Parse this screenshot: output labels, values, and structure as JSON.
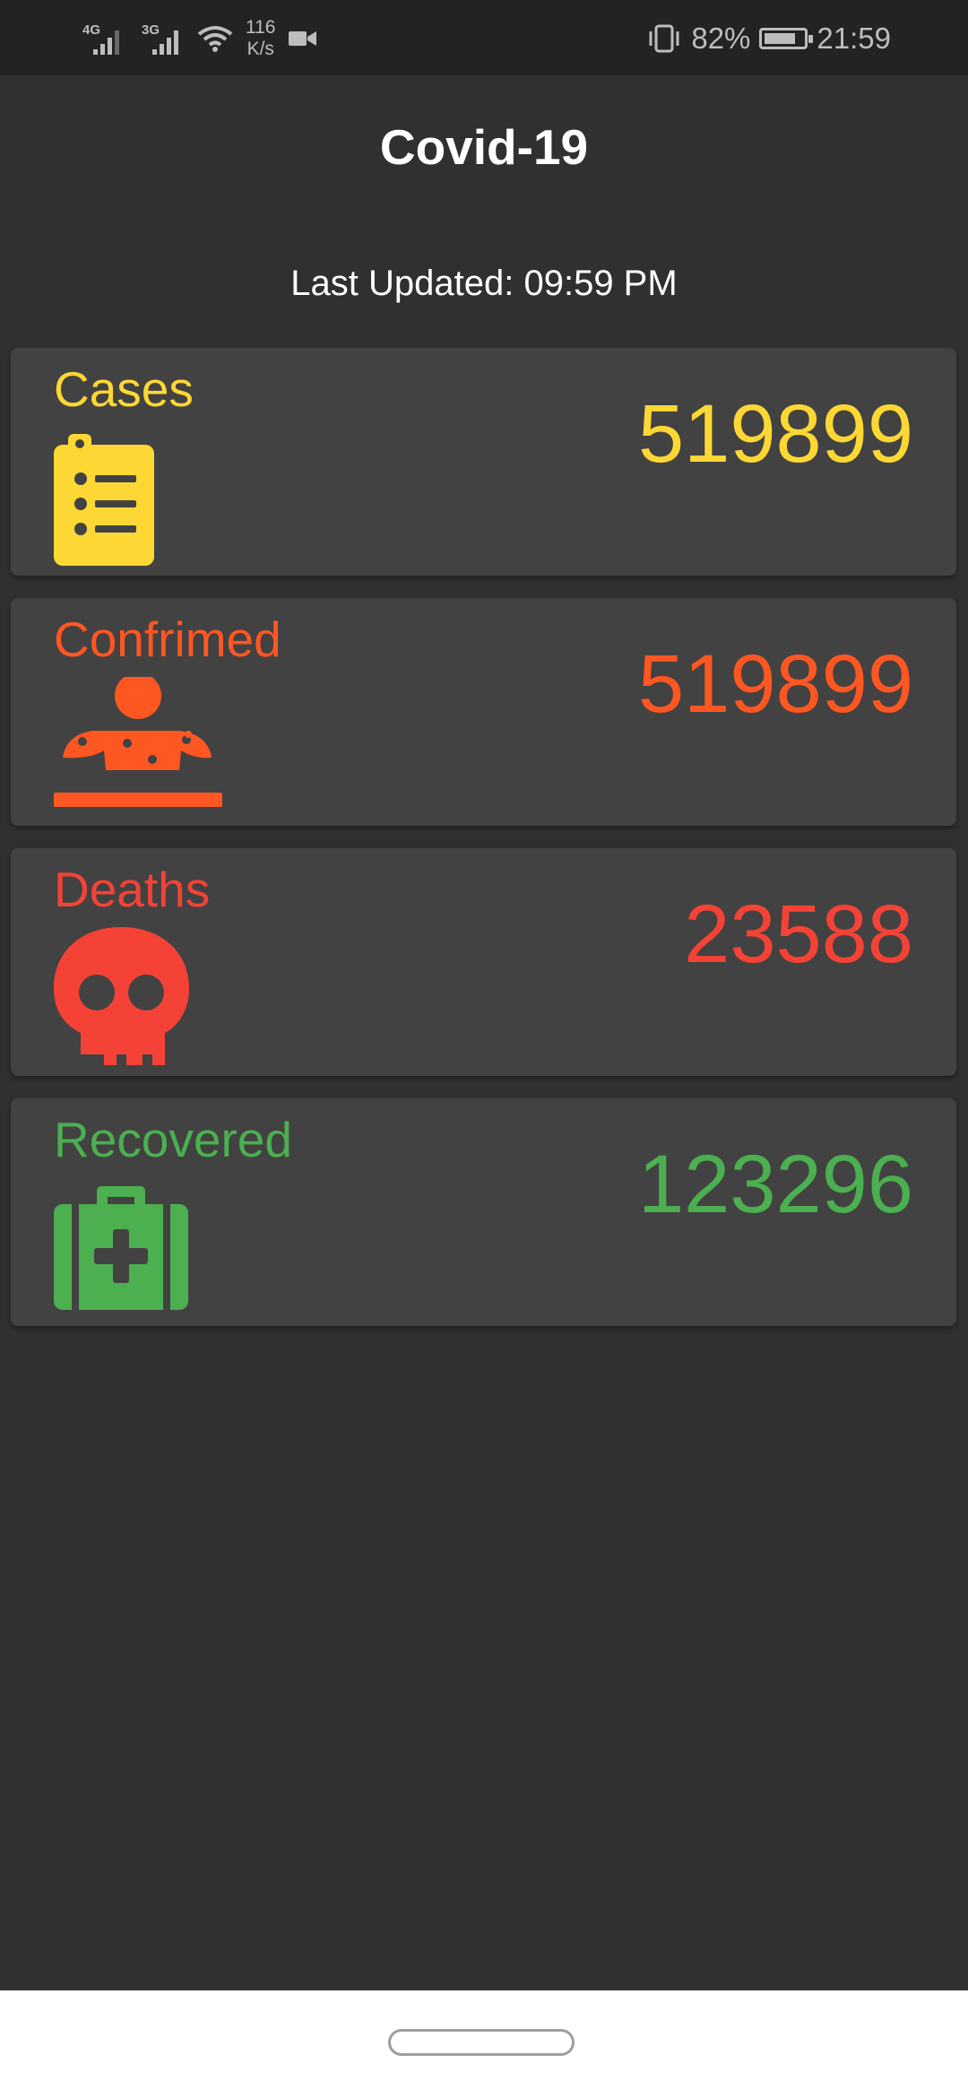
{
  "status_bar": {
    "network_1": "4G",
    "network_2": "3G",
    "speed_value": "116",
    "speed_unit": "K/s",
    "battery_percent": "82%",
    "battery_level": 0.82,
    "time": "21:59"
  },
  "header": {
    "title": "Covid-19"
  },
  "last_updated": "Last Updated: 09:59 PM",
  "cards": [
    {
      "label": "Cases",
      "value": "519899",
      "color": "#fdd835",
      "icon": "clipboard-list-icon"
    },
    {
      "label": "Confrimed",
      "value": "519899",
      "color": "#ff5722",
      "icon": "patient-icon"
    },
    {
      "label": "Deaths",
      "value": "23588",
      "color": "#f44336",
      "icon": "skull-icon"
    },
    {
      "label": "Recovered",
      "value": "123296",
      "color": "#4caf50",
      "icon": "first-aid-kit-icon"
    }
  ]
}
